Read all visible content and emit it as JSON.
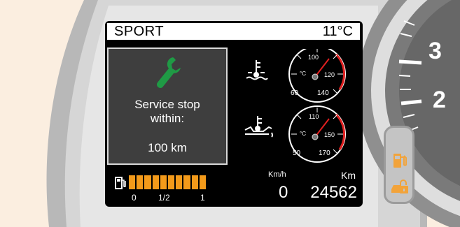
{
  "header": {
    "drive_mode": "SPORT",
    "outside_temp": "11°C"
  },
  "service": {
    "line1": "Service stop",
    "line2": "within:",
    "distance": "100 km",
    "icon": "wrench-icon",
    "icon_color": "#1f9a45"
  },
  "coolant_gauge": {
    "icon": "coolant-temperature-icon",
    "unit": "°C",
    "ticks": [
      "60",
      "100",
      "120",
      "140"
    ],
    "redline_color": "#e02020"
  },
  "oil_gauge": {
    "icon": "oil-temperature-icon",
    "unit": "°C",
    "ticks": [
      "50",
      "110",
      "150",
      "170"
    ],
    "redline_color": "#e02020"
  },
  "fuel": {
    "icon": "fuel-pump-icon",
    "scale": [
      "0",
      "1/2",
      "1"
    ],
    "segments_filled": 10,
    "segments_total": 10,
    "color": "#f39a1a"
  },
  "odometer": {
    "speed_unit": "Km/h",
    "speed": "0",
    "distance_unit": "Km",
    "distance": "24562"
  },
  "tachometer": {
    "visible_label": "3",
    "partial_label": "2"
  },
  "warning_lights": [
    {
      "icon": "fuel-reserve-icon",
      "color": "#f2a33a"
    },
    {
      "icon": "immobilizer-lock-icon",
      "color": "#f2a33a"
    }
  ]
}
